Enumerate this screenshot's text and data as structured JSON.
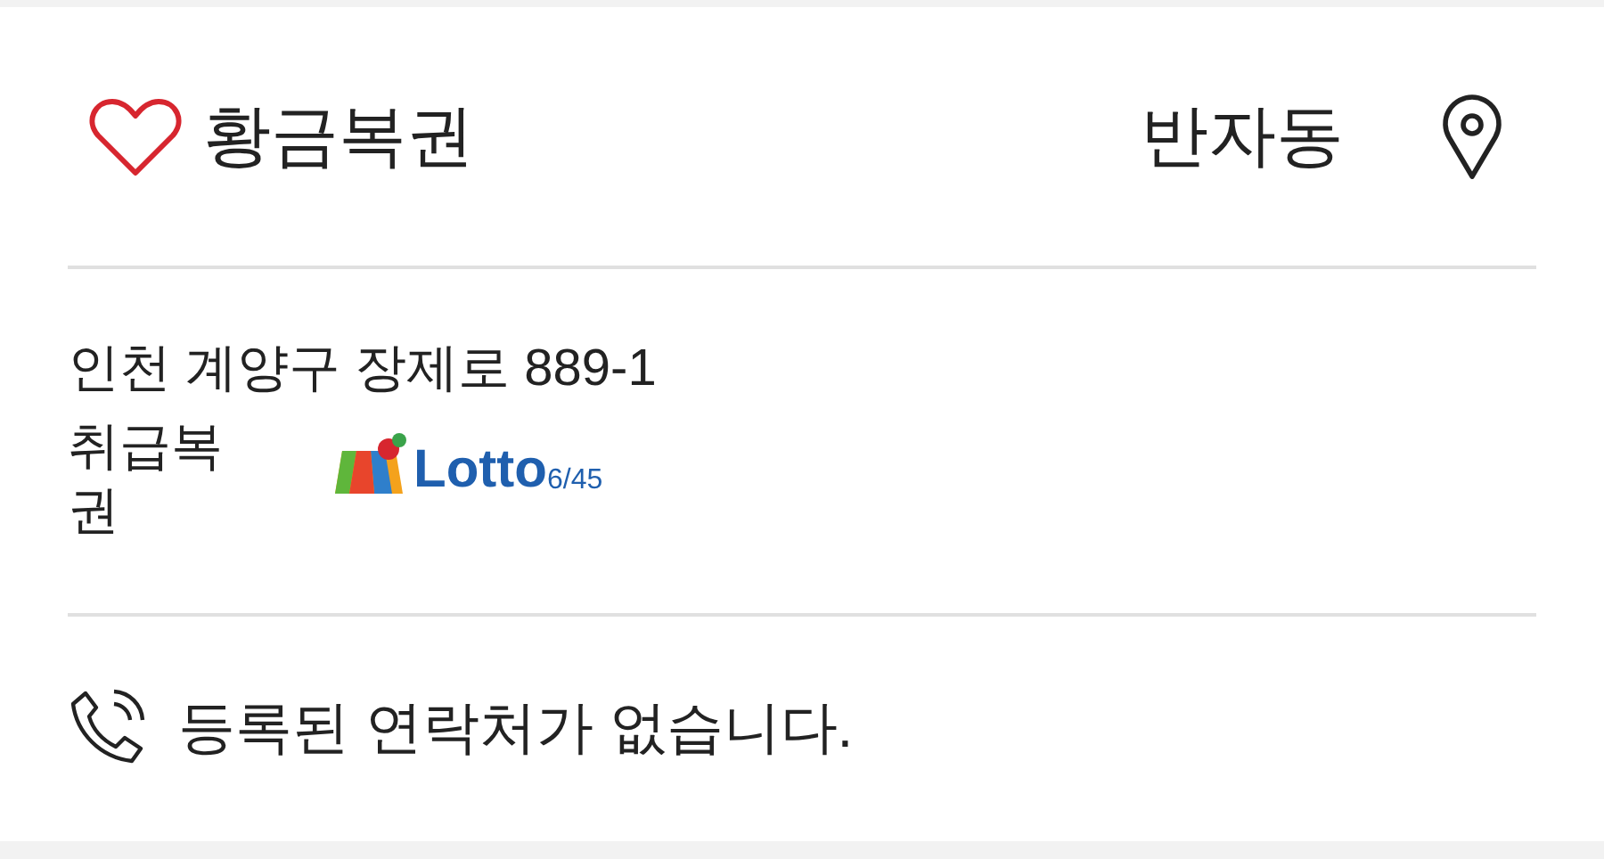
{
  "store": {
    "name": "황금복권",
    "favorite": false,
    "area": "반자동"
  },
  "address": "인천 계양구 장제로 889-1",
  "products": {
    "label": "취급복권",
    "logo": {
      "word": "Lotto",
      "suffix": "6/45"
    }
  },
  "contact": {
    "text": "등록된 연락처가 없습니다."
  }
}
